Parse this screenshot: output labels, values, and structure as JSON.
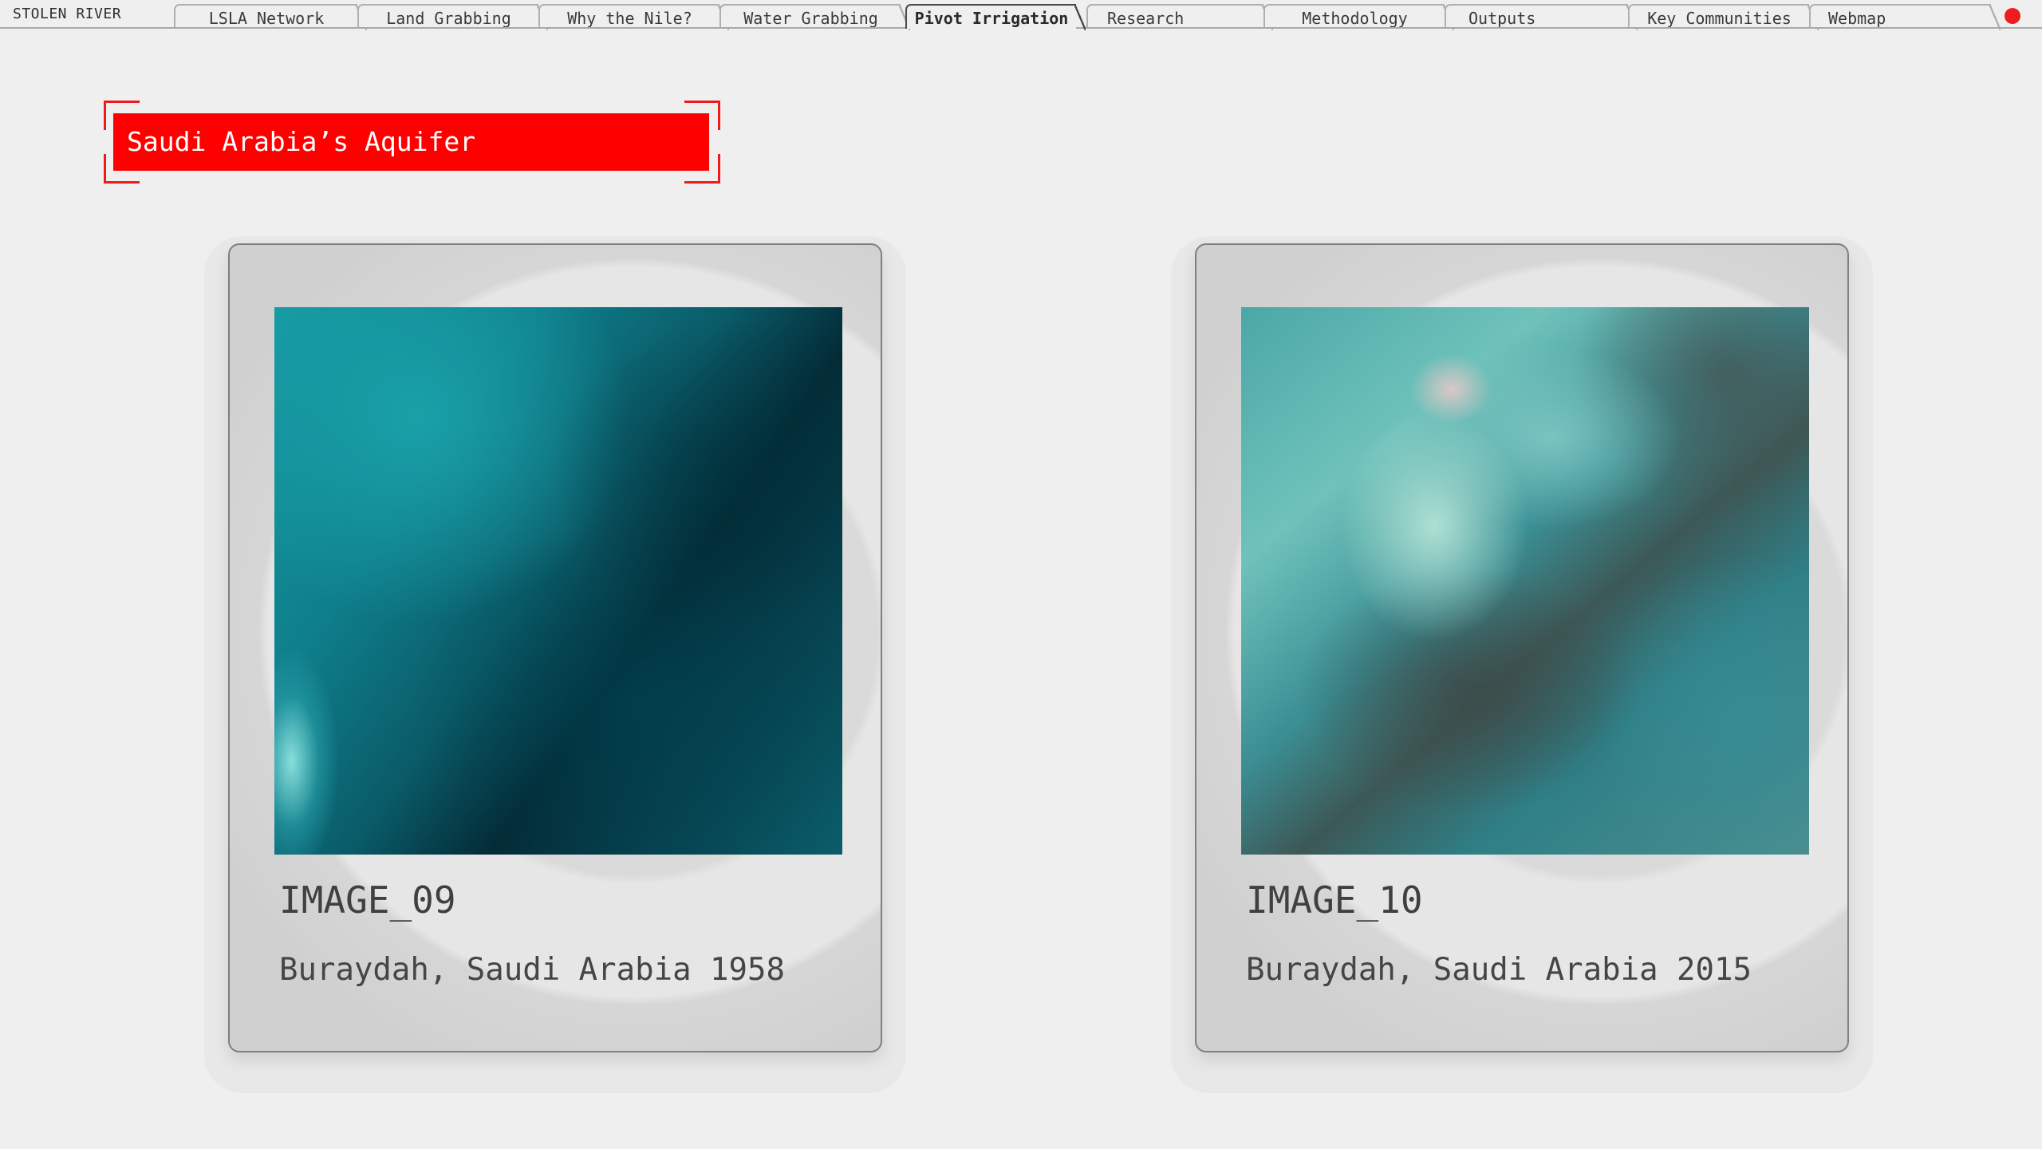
{
  "header": {
    "brand": "STOLEN RIVER",
    "tabs": [
      {
        "label": "LSLA Network",
        "active": false
      },
      {
        "label": "Land Grabbing",
        "active": false
      },
      {
        "label": "Why the Nile?",
        "active": false
      },
      {
        "label": "Water Grabbing",
        "active": false
      },
      {
        "label": "Pivot Irrigation",
        "active": true
      },
      {
        "label": "Research",
        "active": false
      },
      {
        "label": "Methodology",
        "active": false
      },
      {
        "label": "Outputs",
        "active": false
      },
      {
        "label": "Key Communities",
        "active": false
      },
      {
        "label": "Webmap",
        "active": false
      }
    ],
    "indicator_color": "#EE1C1C"
  },
  "section": {
    "title": "Saudi Arabia’s Aquifer",
    "accent_color": "#FF0000"
  },
  "cards": [
    {
      "id": "IMAGE_09",
      "caption": "Buraydah, Saudi Arabia 1958"
    },
    {
      "id": "IMAGE_10",
      "caption": "Buraydah, Saudi Arabia 2015"
    }
  ]
}
